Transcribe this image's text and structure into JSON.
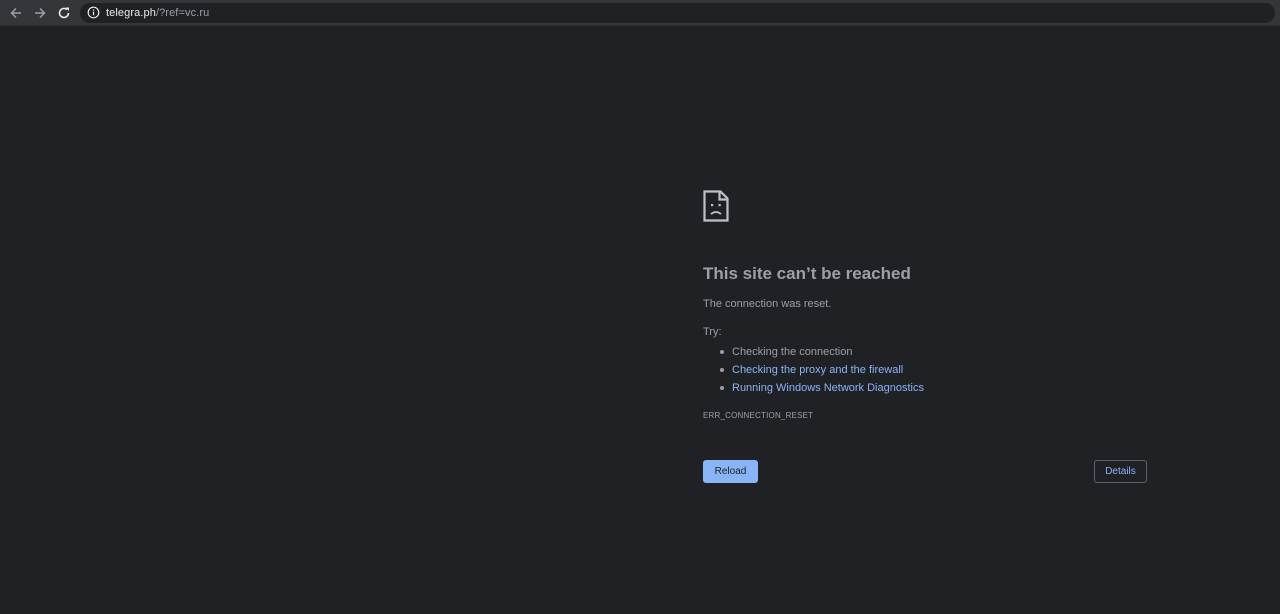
{
  "browser": {
    "icons": {
      "back": "arrow-left-icon",
      "forward": "arrow-right-icon",
      "reload": "reload-icon",
      "site_info": "info-icon"
    },
    "url": {
      "host": "telegra.ph",
      "rest": "/?ref=vc.ru"
    }
  },
  "error_page": {
    "icon": "sad-document-icon",
    "title": "This site can’t be reached",
    "description": "The connection was reset.",
    "try_label": "Try:",
    "suggestions": [
      {
        "label": "Checking the connection",
        "is_link": false
      },
      {
        "label": "Checking the proxy and the firewall",
        "is_link": true
      },
      {
        "label": "Running Windows Network Diagnostics",
        "is_link": true
      }
    ],
    "error_code": "ERR_CONNECTION_RESET",
    "buttons": {
      "reload": "Reload",
      "details": "Details"
    }
  },
  "colors": {
    "background": "#202124",
    "toolbar": "#35363a",
    "text": "#9aa0a6",
    "link": "#8ab4f8",
    "primary_button": "#8ab4f8"
  }
}
